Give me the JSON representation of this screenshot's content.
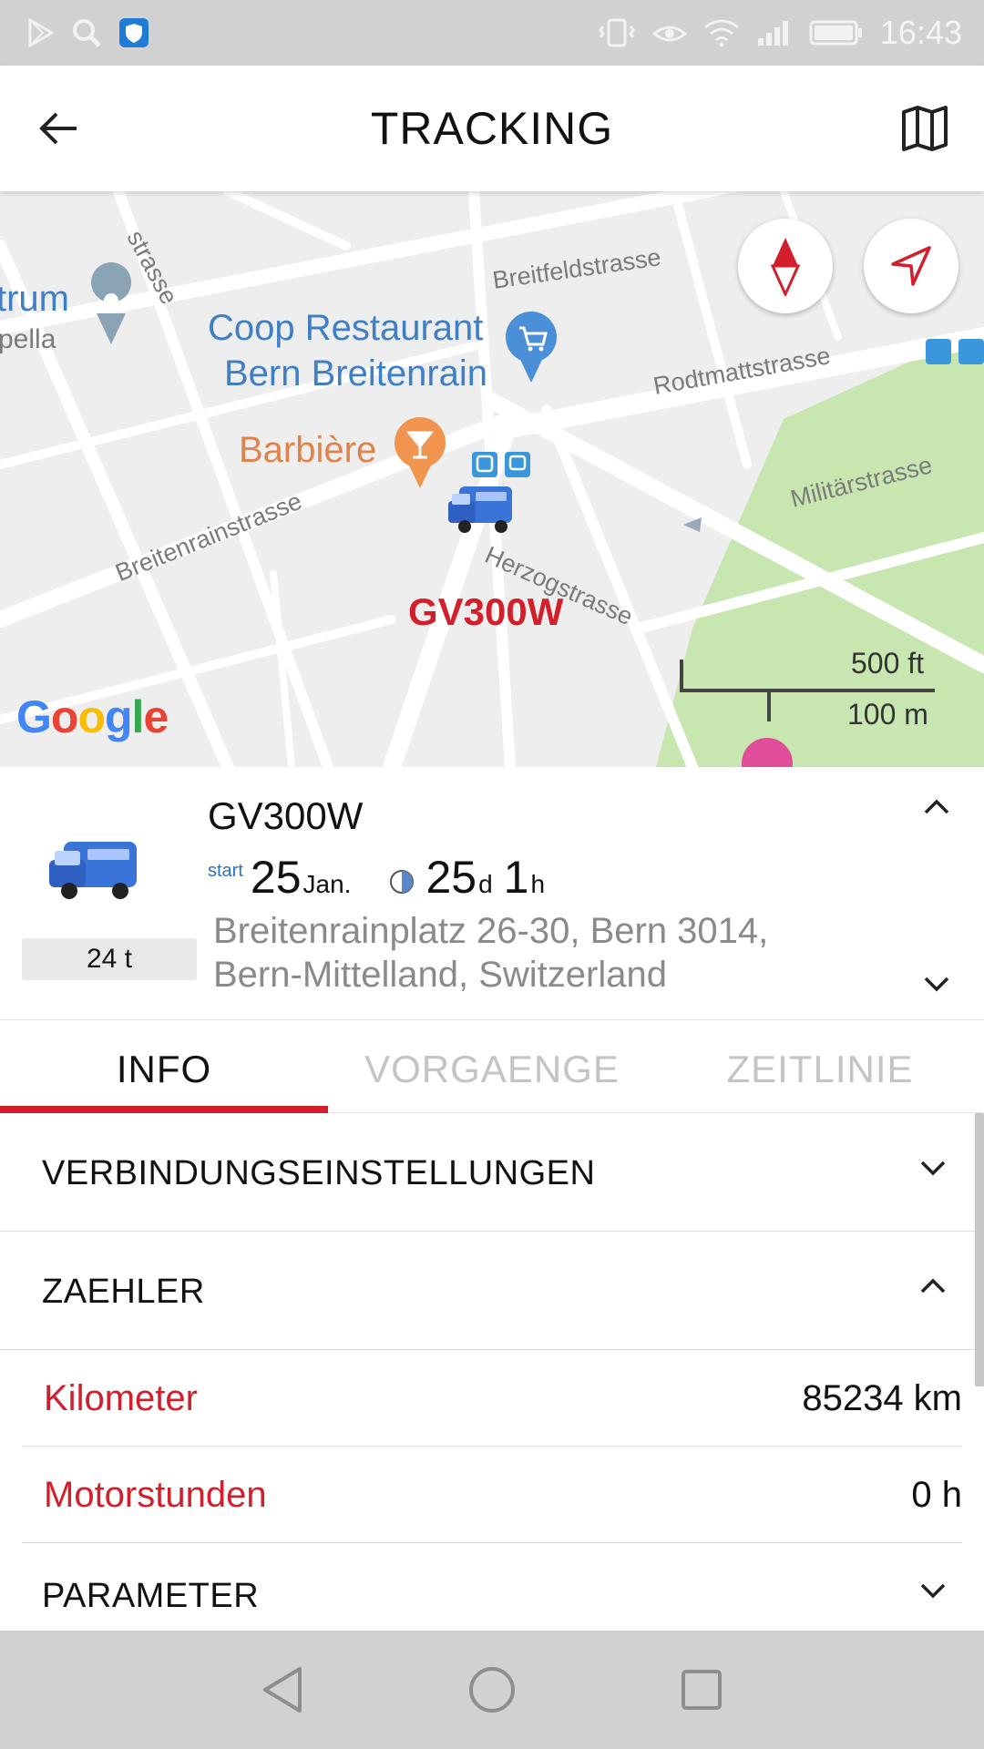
{
  "status_bar": {
    "time": "16:43",
    "icons": [
      "play-store-icon",
      "search-icon",
      "shield-app-icon",
      "vibrate-icon",
      "eye-comfort-icon",
      "wifi-icon",
      "signal-icon",
      "battery-icon"
    ]
  },
  "app_bar": {
    "title": "TRACKING",
    "back_icon": "arrow-left-icon",
    "map_icon": "map-icon"
  },
  "map": {
    "streets": [
      "strasse",
      "Breitfeldstrasse",
      "Rodtmattstrasse",
      "Militärstrasse",
      "Herzogstrasse",
      "Breitenrainstrasse"
    ],
    "pois": {
      "left_partial_line1": "trum",
      "left_partial_line2": "pella",
      "coop_line1": "Coop Restaurant",
      "coop_line2": "Bern Breitenrain",
      "barbiere": "Barbière"
    },
    "vehicle_label": "GV300W",
    "scale_imperial": "500 ft",
    "scale_metric": "100 m",
    "logo": "Google",
    "colors": {
      "park": "#c8e6b0",
      "road": "#ffffff",
      "background": "#eeeeee",
      "vehicle_label": "#d31f2c"
    }
  },
  "vehicle": {
    "name": "GV300W",
    "weight": "24 t",
    "start_label": "start",
    "start_day": "25",
    "start_month": "Jan.",
    "duration_days": "25",
    "duration_days_unit": "d",
    "duration_hours": "1",
    "duration_hours_unit": "h",
    "address_line1": "Breitenrainplatz 26-30, Bern 3014,",
    "address_line2": "Bern-Mittelland, Switzerland"
  },
  "tabs": [
    {
      "label": "INFO",
      "active": true
    },
    {
      "label": "VORGAENGE",
      "active": false
    },
    {
      "label": "ZEITLINIE",
      "active": false
    }
  ],
  "sections": {
    "connection": {
      "title": "VERBINDUNGSEINSTELLUNGEN",
      "expanded": false
    },
    "counter": {
      "title": "ZAEHLER",
      "expanded": true,
      "rows": [
        {
          "key": "Kilometer",
          "value": "85234 km"
        },
        {
          "key": "Motorstunden",
          "value": "0 h"
        }
      ]
    },
    "parameter": {
      "title": "PARAMETER",
      "expanded": false
    }
  },
  "accent_color": "#d31f2c"
}
